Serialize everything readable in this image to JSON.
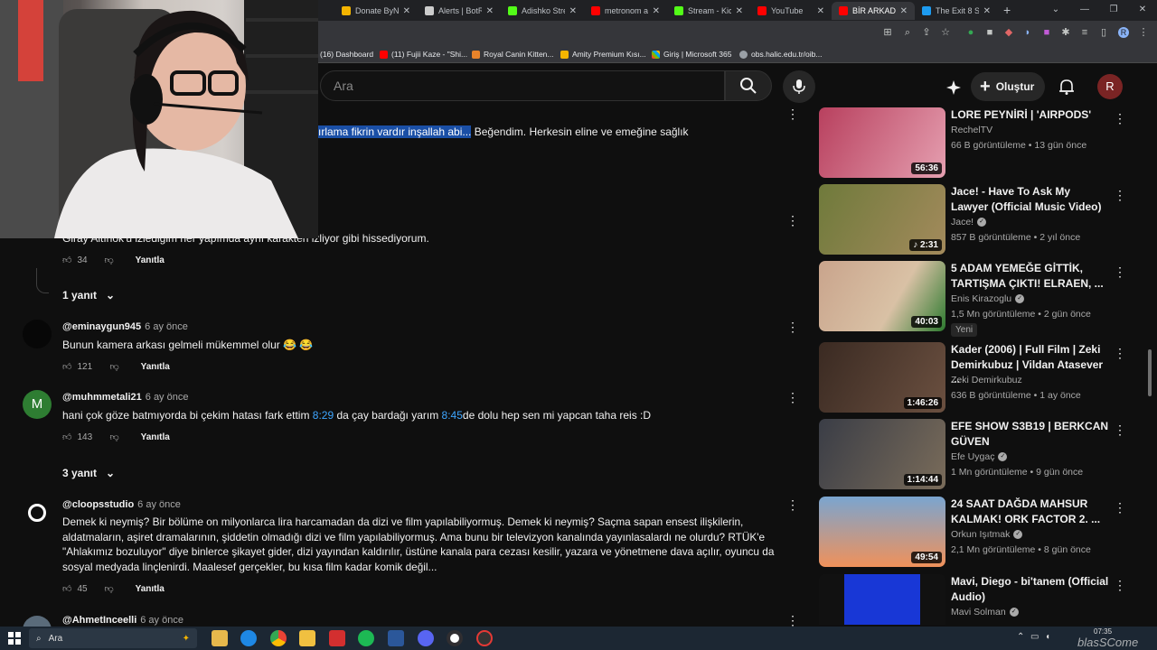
{
  "browser": {
    "tabs": [
      {
        "label": "Donate ByNo",
        "color": "#f4b400"
      },
      {
        "label": "Alerts | BotR",
        "color": "#cccccc"
      },
      {
        "label": "Adishko Strea",
        "color": "#53fc18"
      },
      {
        "label": "metronom al",
        "color": "#ff0000"
      },
      {
        "label": "Stream - Kick",
        "color": "#53fc18"
      },
      {
        "label": "YouTube",
        "color": "#ff0000"
      },
      {
        "label": "BİR ARKADAŞ",
        "color": "#ff0000"
      },
      {
        "label": "The Exit 8 St",
        "color": "#1d9bf0"
      }
    ],
    "bookmarks": [
      "(16) Dashboard",
      "(11) Fujii Kaze - \"Shi...",
      "Royal Canin Kitten...",
      "Amity Premium Kısı...",
      "Giriş | Microsoft 365",
      "obs.halic.edu.tr/oib..."
    ],
    "profile_initial": "R"
  },
  "header": {
    "search_placeholder": "Ara",
    "create_label": "Oluştur",
    "avatar_initial": "R"
  },
  "comments": {
    "top_partial": {
      "highlight": "ırlama fikrin vardır inşallah abi...",
      "rest": " Beğendim. Herkesin eline ve emeğine sağlık"
    },
    "partial2": {
      "text": "Giray Altınok'u izlediğim her yapımda aynı karakteri izliyor gibi hissediyorum.",
      "likes": "34",
      "reply": "Yanıtla"
    },
    "replies_toggle_1": "1 yanıt",
    "items": [
      {
        "handle": "@eminaygun945",
        "time": "6 ay önce",
        "text": "Bunun kamera arkası gelmeli mükemmel olur 😂 😂",
        "likes": "121",
        "reply": "Yanıtla"
      },
      {
        "handle": "@muhmmetali21",
        "time": "6 ay önce",
        "text_a": "hani çok göze batmıyorda bi çekim hatası fark ettim ",
        "ts1": "8:29",
        "text_b": " da çay bardağı yarım ",
        "ts2": "8:45",
        "text_c": "de dolu hep sen mi yapcan taha reis :D",
        "likes": "143",
        "reply": "Yanıtla",
        "avatar_letter": "M"
      },
      {
        "handle": "@cloopsstudio",
        "time": "6 ay önce",
        "text": "Demek ki neymiş? Bir bölüme on milyonlarca lira harcamadan da dizi ve film yapılabiliyormuş. Demek ki neymiş? Saçma sapan ensest ilişkilerin, aldatmaların, aşiret dramalarının, şiddetin olmadığı dizi ve film yapılabiliyormuş. Ama bunu bir televizyon kanalında yayınlasalardı ne olurdu? RTÜK'e \"Ahlakımız bozuluyor\" diye binlerce şikayet gider, dizi yayından kaldırılır, üstüne kanala para cezası kesilir, yazara ve yönetmene dava açılır, oyuncu da sosyal medyada linçlenirdi. Maalesef gerçekler, bu kısa film kadar komik değil...",
        "likes": "45",
        "reply": "Yanıtla"
      },
      {
        "handle": "@AhmetInceelli",
        "time": "6 ay önce"
      }
    ],
    "replies_toggle_3": "3 yanıt"
  },
  "sidebar": {
    "videos": [
      {
        "title": "LORE PEYNİRİ | 'AIRPODS'",
        "channel": "RechelTV",
        "meta": "66 B görüntüleme • 13 gün önce",
        "duration": "56:36",
        "colors": [
          "#b8405e",
          "#e59fb0"
        ]
      },
      {
        "title": "Jace! - Have To Ask My Lawyer (Official Music Video)",
        "channel": "Jace!",
        "verified": true,
        "meta": "857 B görüntüleme • 2 yıl önce",
        "duration": "♪ 2:31",
        "colors": [
          "#6f7a3b",
          "#a38a5c"
        ]
      },
      {
        "title": "5 ADAM YEMEĞE GİTTİK, TARTIŞMA ÇIKTI! ELRAEN, ...",
        "channel": "Enis Kirazoglu",
        "verified": true,
        "meta": "1,5 Mn görüntüleme • 2 gün önce",
        "badge": "Yeni",
        "duration": "40:03",
        "colors": [
          "#c9a48c",
          "#2d7a2f"
        ]
      },
      {
        "title": "Kader (2006) | Full Film | Zeki Demirkubuz | Vildan Atasever ...",
        "channel": "Zeki Demirkubuz",
        "meta": "636 B görüntüleme • 1 ay önce",
        "duration": "1:46:26",
        "colors": [
          "#3a2a22",
          "#6b5040"
        ]
      },
      {
        "title": "EFE SHOW S3B19 | BERKCAN GÜVEN",
        "channel": "Efe Uygaç",
        "verified": true,
        "meta": "1 Mn görüntüleme • 9 gün önce",
        "duration": "1:14:44",
        "colors": [
          "#3a3d46",
          "#7a6c5a"
        ]
      },
      {
        "title": "24 SAAT DAĞDA MAHSUR KALMAK! ORK FACTOR 2. ...",
        "channel": "Orkun Işıtmak",
        "verified": true,
        "meta": "2,1 Mn görüntüleme • 8 gün önce",
        "duration": "49:54",
        "colors": [
          "#f0915a",
          "#7aa5d0"
        ]
      },
      {
        "title": "Mavi, Diego - bi'tanem (Official Audio)",
        "channel": "Mavi Solman",
        "verified": true,
        "meta": "",
        "duration": "",
        "colors": [
          "#1837d6",
          "#2a2a2a"
        ]
      }
    ]
  },
  "taskbar": {
    "search_label": "Ara",
    "time": "07:35"
  },
  "watermark": "blasSCome"
}
